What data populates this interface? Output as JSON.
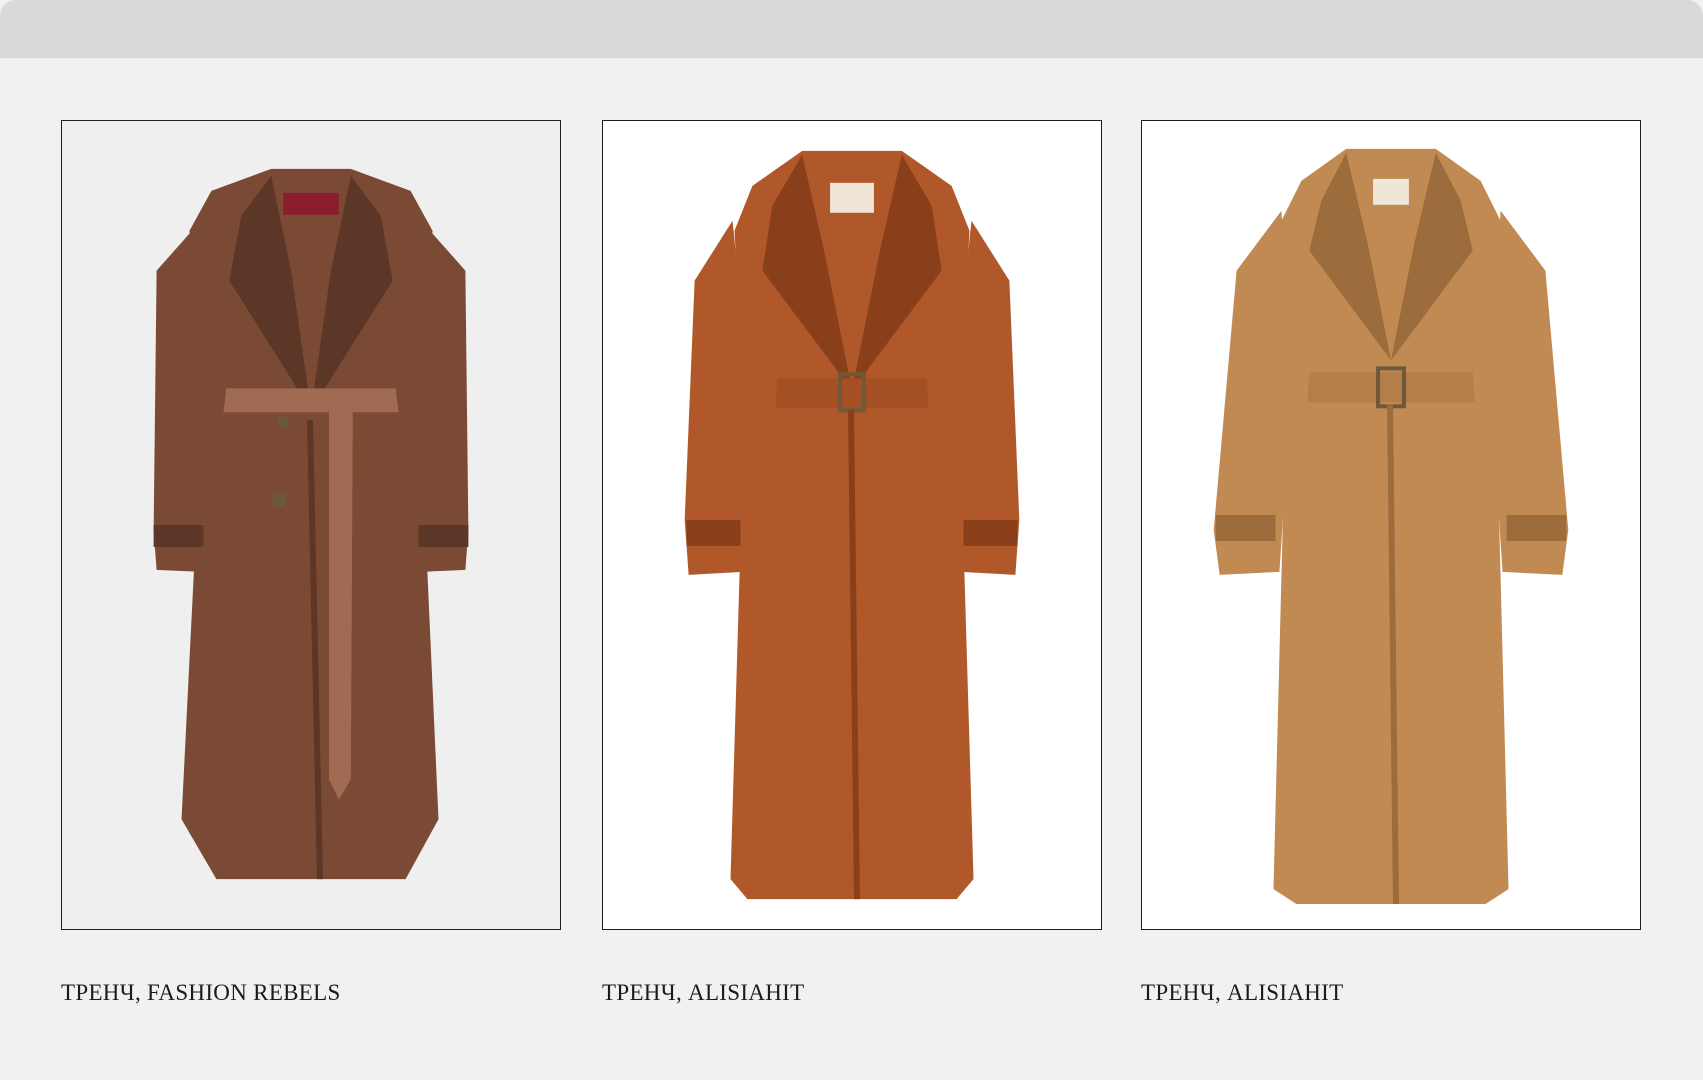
{
  "products": [
    {
      "caption": "ТРЕНЧ, FASHION REBELS",
      "image_icon": "suede-trench-coat-photo",
      "colors": {
        "coat": "#7a4a35",
        "shadow": "#5c3626",
        "belt": "#a06b52",
        "background": "#efefef",
        "label": "#8b1d2c"
      }
    },
    {
      "caption": "ТРЕНЧ, ALISIAHIT",
      "image_icon": "leather-trench-coat-photo",
      "colors": {
        "coat": "#b0582a",
        "shadow": "#8a3f1b",
        "belt": "#a44f24",
        "background": "#ffffff",
        "label": "#efe6d8"
      }
    },
    {
      "caption": "ТРЕНЧ, ALISIAHIT",
      "image_icon": "camel-trench-coat-photo",
      "colors": {
        "coat": "#c08a52",
        "shadow": "#9c6c3c",
        "belt": "#b47e48",
        "background": "#ffffff",
        "label": "#efe6d8"
      }
    }
  ]
}
